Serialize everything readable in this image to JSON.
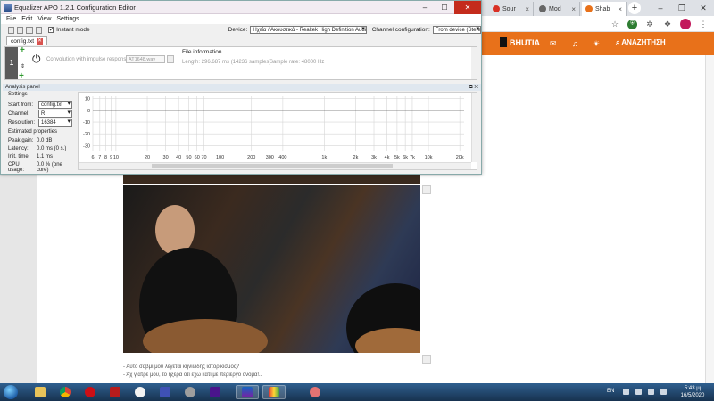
{
  "browser": {
    "tabs": [
      {
        "label": "Sour"
      },
      {
        "label": "Mod"
      },
      {
        "label": "Shab"
      }
    ]
  },
  "site": {
    "logo_text": "BHUTIA",
    "search_label": "ΑΝΑΖΗΤΗΣΗ",
    "accent_color": "#e8711a",
    "comments": [
      "- Αυτό σαβμι μου λέγεται κηνιώδης ιστόρικισμός?",
      "- Άχ γιατρέ μου, το ήξερα ότι έχω κάτι με περίεργο όνομα!.."
    ]
  },
  "eq": {
    "title": "Equalizer APO 1.2.1 Configuration Editor",
    "menu": [
      "File",
      "Edit",
      "View",
      "Settings"
    ],
    "instant_mode_label": "Instant mode",
    "device_label": "Device:",
    "device_value": "Ηχεία / Ακουστικά - Realtek High Definition Audio",
    "channel_config_label": "Channel configuration:",
    "channel_config_value": "From device (Stereo)",
    "file_tab": "config.txt",
    "filter": {
      "number": "1",
      "conv_label": "Convolution with impulse response:",
      "conv_file": "AT1648.wav",
      "fileinfo_title": "File information",
      "length": "Length: 296.687 ms (14236 samples)",
      "sample_rate": "Sample rate: 48000 Hz"
    },
    "analysis": {
      "title": "Analysis panel",
      "settings_title": "Settings",
      "start_from_label": "Start from:",
      "start_from_value": "config.txt",
      "channel_label": "Channel:",
      "channel_value": "R",
      "resolution_label": "Resolution:",
      "resolution_value": "16384",
      "estimated_title": "Estimated properties",
      "peak_gain_label": "Peak gain:",
      "peak_gain_value": "0.0 dB",
      "latency_label": "Latency:",
      "latency_value": "0.0 ms (0 s.)",
      "init_time_label": "Init. time:",
      "init_time_value": "1.1 ms",
      "cpu_label": "CPU usage:",
      "cpu_value": "0.0 % (one core)"
    }
  },
  "chart_data": {
    "type": "line",
    "xscale": "log",
    "xlim": [
      6,
      22000
    ],
    "ylim": [
      -35,
      12
    ],
    "yticks": [
      "10",
      "0",
      "-10",
      "-20",
      "-30"
    ],
    "xticks": [
      "6",
      "7",
      "8",
      "9",
      "10",
      "20",
      "30",
      "40",
      "50",
      "60",
      "70",
      "100",
      "200",
      "300",
      "400",
      "1k",
      "2k",
      "3k",
      "4k",
      "5k",
      "6k",
      "7k",
      "10k",
      "20k"
    ],
    "series": [
      {
        "x": [
          6,
          22000
        ],
        "y": [
          0,
          0
        ]
      }
    ]
  },
  "taskbar": {
    "lang": "EN",
    "time": "5:43 μμ",
    "date": "16/5/2020"
  }
}
